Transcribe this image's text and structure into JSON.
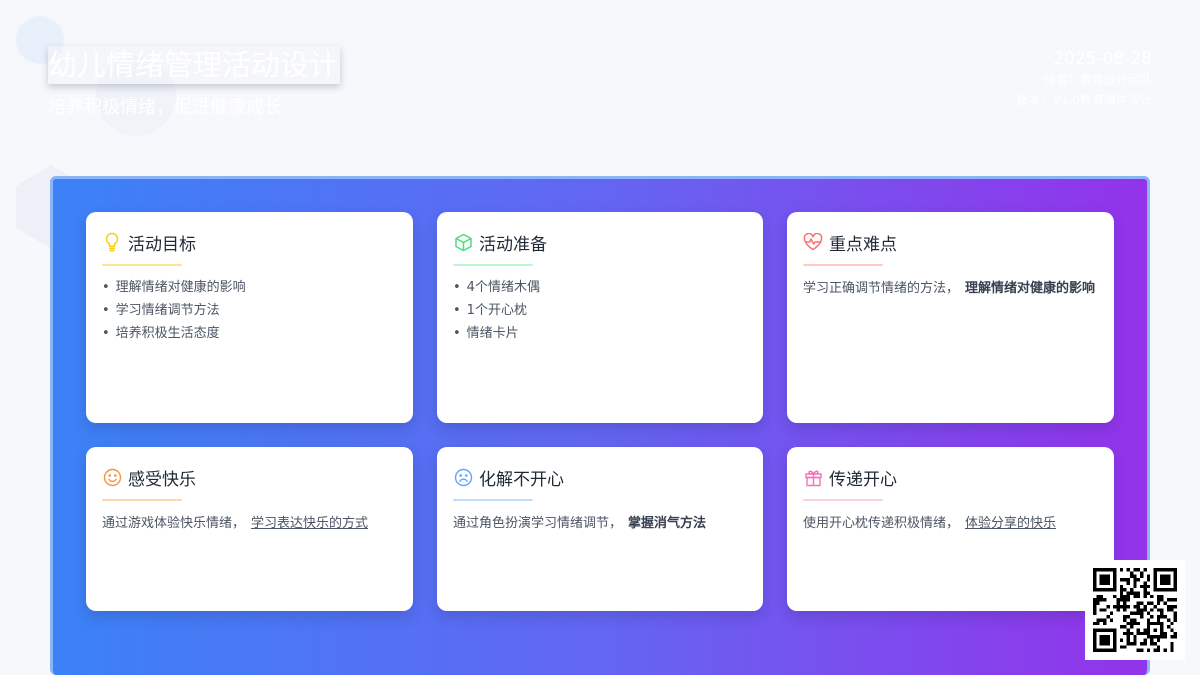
{
  "header": {
    "title": "幼儿情绪管理活动设计",
    "subtitle": "培养积极情绪，促进健康成长",
    "date": "2025-08-28",
    "author": "作者：教育设计团队",
    "version": "版本：V1.0教育课件设计"
  },
  "cards": [
    {
      "icon": "lightbulb-icon",
      "title": "活动目标",
      "accent": "#facc15",
      "items": [
        "理解情绪对健康的影响",
        "学习情绪调节方法",
        "培养积极生活态度"
      ]
    },
    {
      "icon": "box-icon",
      "title": "活动准备",
      "accent": "#4ade80",
      "items": [
        "4个情绪木偶",
        "1个开心枕",
        "情绪卡片"
      ]
    },
    {
      "icon": "heartbeat-icon",
      "title": "重点难点",
      "accent": "#f87171",
      "text": "学习正确调节情绪的方法，",
      "emphasis": "理解情绪对健康的影响"
    },
    {
      "icon": "smile-icon",
      "title": "感受快乐",
      "accent": "#fb923c",
      "text": "通过游戏体验快乐情绪，",
      "underline": "学习表达快乐的方式"
    },
    {
      "icon": "frown-icon",
      "title": "化解不开心",
      "accent": "#60a5fa",
      "text": "通过角色扮演学习情绪调节，",
      "emphasis": "掌握消气方法"
    },
    {
      "icon": "gift-icon",
      "title": "传递开心",
      "accent": "#f472b6",
      "text": "使用开心枕传递积极情绪，",
      "underline": "体验分享的快乐"
    }
  ],
  "colors": {
    "gradient_start": "#3b82f6",
    "gradient_mid": "#6366f1",
    "gradient_end": "#9333ea"
  }
}
